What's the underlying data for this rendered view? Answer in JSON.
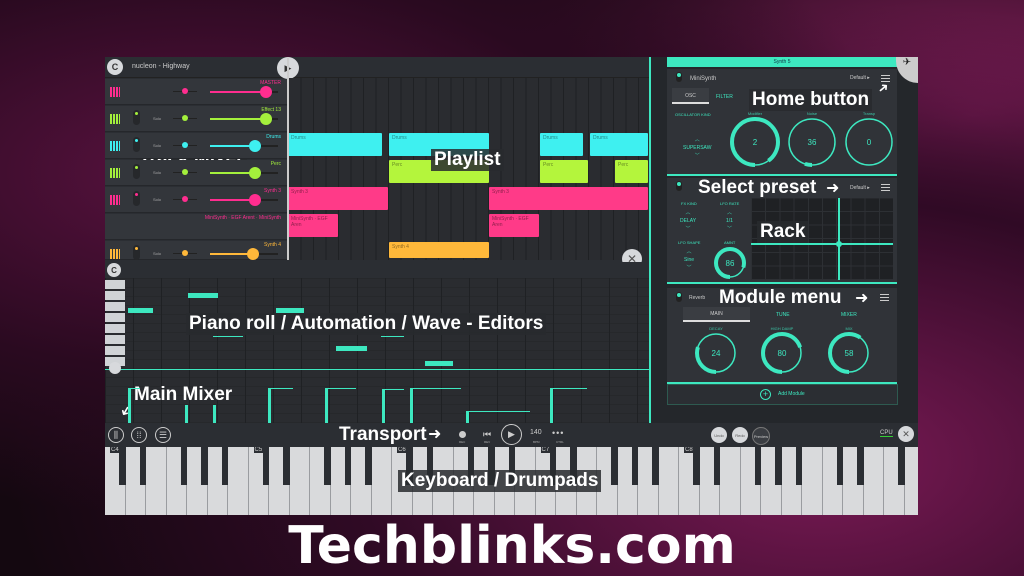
{
  "app": {
    "song_title": "nucleon - Highway"
  },
  "mixer": {
    "tracks": [
      {
        "name": "MASTER",
        "color": "#ff2d8f",
        "solo": ""
      },
      {
        "name": "Effect 13",
        "color": "#a4f03c",
        "solo": "Solo"
      },
      {
        "name": "Drums",
        "color": "#3ef0f0",
        "solo": "Solo"
      },
      {
        "name": "Perc",
        "color": "#a4f03c",
        "solo": "Solo"
      },
      {
        "name": "Synth 3",
        "color": "#ff2d8f",
        "solo": "Solo"
      },
      {
        "name": "MiniSynth · EGF Arent · MiniSynth",
        "color": "#ff2d8f",
        "solo": ""
      },
      {
        "name": "Synth 4",
        "color": "#ffb83a",
        "solo": "Solo"
      }
    ]
  },
  "playlist": {
    "clips": [
      {
        "label": "Drums",
        "color": "#3ef0f0"
      },
      {
        "label": "Drums",
        "color": "#3ef0f0"
      },
      {
        "label": "Drums",
        "color": "#3ef0f0"
      },
      {
        "label": "Drums",
        "color": "#3ef0f0"
      },
      {
        "label": "Perc",
        "color": "#b4f53c"
      },
      {
        "label": "Perc",
        "color": "#b4f53c"
      },
      {
        "label": "Perc",
        "color": "#b4f53c"
      },
      {
        "label": "Synth 3",
        "color": "#ff3a88"
      },
      {
        "label": "Synth 3",
        "color": "#ff3a88"
      },
      {
        "label": "MiniSynth · EGF Aren",
        "color": "#ff3a88"
      },
      {
        "label": "MiniSynth · EGF Aren",
        "color": "#ff3a88"
      },
      {
        "label": "Synth 4",
        "color": "#ffb83a"
      }
    ]
  },
  "rack": {
    "header": "Synth 5",
    "synth": {
      "name": "MiniSynth",
      "preset": "Default ▸",
      "tabs": [
        "OSC",
        "FILTER"
      ],
      "osc_label": "OSCILLATOR KIND",
      "osc_value": "SUPERSAW",
      "knobs": [
        {
          "label": "Modifier",
          "value": "2"
        },
        {
          "label": "Noise",
          "value": "36"
        },
        {
          "label": "Transp",
          "value": "0"
        }
      ]
    },
    "fx": {
      "preset": "Default ▸",
      "fx_kind_label": "FX KIND",
      "fx_kind": "DELAY",
      "lfo_rate_label": "LFO RATE",
      "lfo_rate": "1/1",
      "lfo_shape_label": "LFO SHAPE",
      "lfo_shape": "Sine",
      "amnt_label": "AMNT",
      "amnt": "86"
    },
    "reverb": {
      "name": "Reverb",
      "tabs": [
        "MAIN",
        "TUNE",
        "MIXER"
      ],
      "knobs": [
        {
          "label": "DECAY",
          "value": "24"
        },
        {
          "label": "HIGH DAMP",
          "value": "80"
        },
        {
          "label": "MIX",
          "value": "58"
        }
      ]
    },
    "add_module": "Add Module"
  },
  "transport": {
    "rec": "REC",
    "rev": "REV",
    "bpm": "140",
    "bpm_label": "BPM",
    "ctrl": "CTRL",
    "undo": "Undo",
    "redo": "Redo",
    "preview": "Preview",
    "cpu": "CPU"
  },
  "keyboard": {
    "octaves": [
      "C4",
      "C5",
      "C6",
      "C7",
      "C8"
    ]
  },
  "annotations": {
    "track_mixer": "Track Mixer",
    "playlist": "Playlist",
    "home": "Home button",
    "select_preset": "Select preset",
    "rack": "Rack",
    "module_menu": "Module menu",
    "editors": "Piano roll / Automation / Wave - Editors",
    "main_mixer": "Main Mixer",
    "transport": "Transport",
    "keyboard": "Keyboard / Drumpads"
  },
  "footer": {
    "site": "Techblinks.com"
  },
  "colors": {
    "accent": "#3de8c0"
  }
}
